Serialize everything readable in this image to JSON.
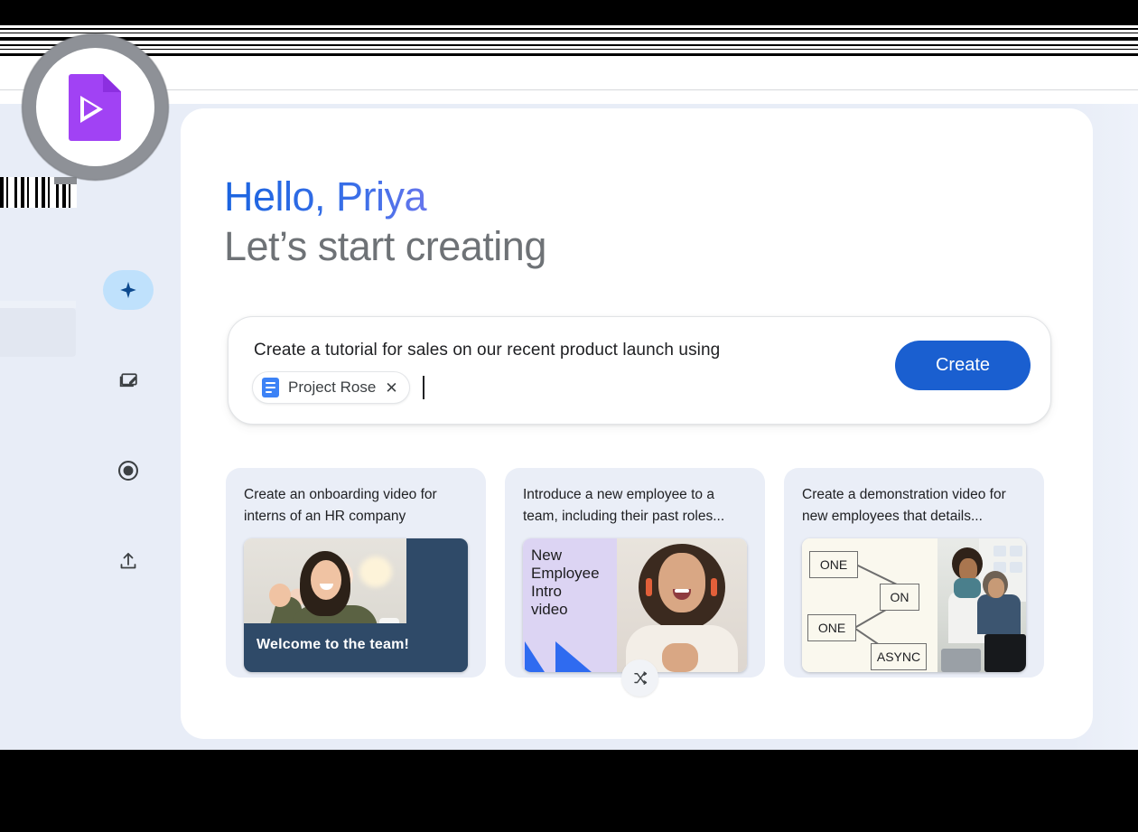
{
  "app": {
    "logo_icon": "video-doc-play-icon",
    "brand_color": "#a142f4"
  },
  "sidebar": {
    "items": [
      {
        "id": "generate",
        "icon": "sparkle-icon",
        "active": true
      },
      {
        "id": "edit",
        "icon": "slides-edit-icon",
        "active": false
      },
      {
        "id": "record",
        "icon": "record-circle-icon",
        "active": false
      },
      {
        "id": "upload",
        "icon": "upload-icon",
        "active": false
      }
    ]
  },
  "greeting": {
    "hello": "Hello, Priya",
    "subtitle": "Let’s start creating"
  },
  "prompt": {
    "text": "Create a tutorial for sales on our recent product launch using",
    "chip": {
      "label": "Project Rose",
      "icon": "google-docs-icon",
      "remove_icon": "close-icon"
    },
    "create_label": "Create",
    "accent_color": "#1a5fd0"
  },
  "suggestions": {
    "shuffle_icon": "shuffle-icon",
    "cards": [
      {
        "title": "Create an onboarding video for interns of an HR company",
        "thumbnail_caption": "Welcome to the team!"
      },
      {
        "title": "Introduce a new employee to a team, including their past roles...",
        "thumbnail_title": "New\nEmployee\nIntro\nvideo",
        "thumbnail_title_lines": [
          "New",
          "Employee",
          "Intro",
          "video"
        ]
      },
      {
        "title": "Create a demonstration video for new employees that details...",
        "thumbnail_boxes": [
          "ONE",
          "ON",
          "ONE",
          "ASYNC"
        ]
      }
    ]
  }
}
